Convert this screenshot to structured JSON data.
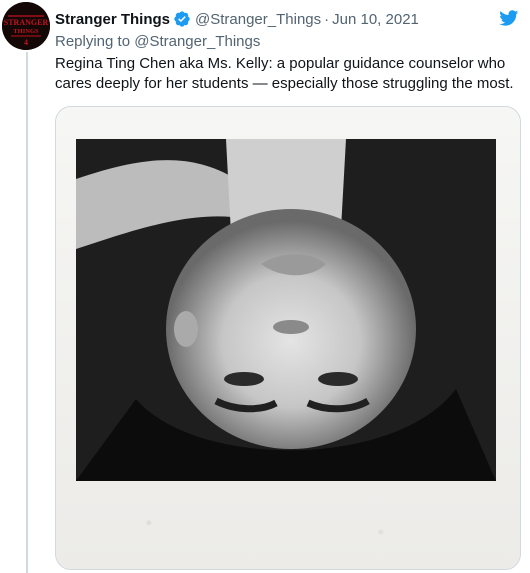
{
  "tweet": {
    "display_name": "Stranger Things",
    "handle": "@Stranger_Things",
    "separator": "·",
    "date": "Jun 10, 2021",
    "replying_to_prefix": "Replying to",
    "replying_to_handle": "@Stranger_Things",
    "text": "Regina Ting Chen aka Ms. Kelly: a popular guidance counselor who cares deeply for her students — especially those struggling the most.",
    "avatar_text": "STRANGER THINGS",
    "verified_icon": "verified-badge-icon",
    "brand_icon": "twitter-bird-icon",
    "colors": {
      "verified": "#1d9bf0",
      "twitter": "#1d9bf0",
      "secondary_text": "#536471",
      "primary_text": "#0f1419",
      "avatar_logo": "#c1121f"
    }
  },
  "media": {
    "type": "photo",
    "subject": "upside-down black and white polaroid portrait"
  }
}
